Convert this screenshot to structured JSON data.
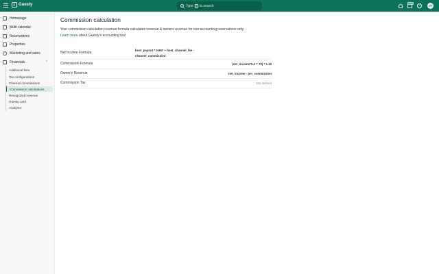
{
  "brand": {
    "name": "Guesty"
  },
  "search": {
    "prefix": "Type",
    "key": "/",
    "suffix": "to search"
  },
  "header": {
    "badge": "NEW",
    "help": "?",
    "avatar_initials": "VP"
  },
  "sidebar": {
    "items": [
      {
        "label": "Homepage"
      },
      {
        "label": "Multi calendar"
      },
      {
        "label": "Reservations"
      },
      {
        "label": "Properties"
      },
      {
        "label": "Marketing and sales"
      },
      {
        "label": "Financials"
      }
    ],
    "financials_sub": [
      {
        "label": "Additional fees"
      },
      {
        "label": "Tax configurations"
      },
      {
        "label": "Channel commissions"
      },
      {
        "label": "Commission calculations"
      },
      {
        "label": "Recognized revenue"
      },
      {
        "label": "Guesty card"
      },
      {
        "label": "Analytics"
      }
    ]
  },
  "main": {
    "title": "Commission calculation",
    "description": "Your commission calculation revenue formula calculates revenue & owners revenue for non-accounting reservations only.",
    "link_text": "Learn more",
    "link_suffix": "about Guesty's accounting tool",
    "rows": [
      {
        "label": "Net Income Formula",
        "value": "host_payout * 0.967 + host_channel_fee - channel_commission"
      },
      {
        "label": "Commission Formula",
        "value": "(net_income*0.2 = 70) * 1.19"
      },
      {
        "label": "Owner's Revenue",
        "value": "net_income - pm_commission"
      },
      {
        "label": "Commission Tax",
        "value": "Not defined"
      }
    ]
  }
}
